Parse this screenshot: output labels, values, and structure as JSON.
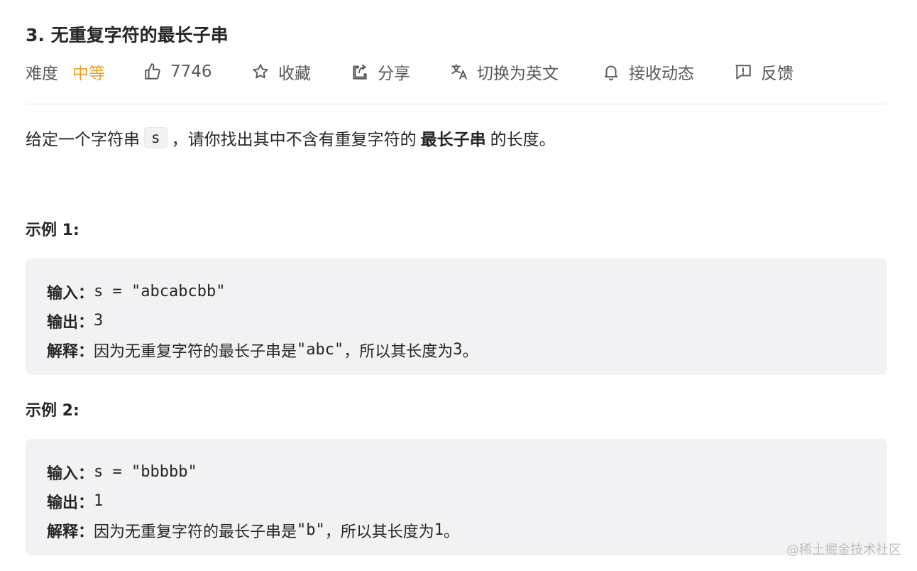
{
  "problem": {
    "title": "3. 无重复字符的最长子串"
  },
  "toolbar": {
    "difficulty_label": "难度",
    "difficulty_value": "中等",
    "likes_count": "7746",
    "favorite_label": "收藏",
    "share_label": "分享",
    "translate_label": "切换为英文",
    "subscribe_label": "接收动态",
    "feedback_label": "反馈",
    "difficulty_color": "#ef9e2b",
    "icons": [
      "thumbs-up-icon",
      "star-icon",
      "share-icon",
      "translate-icon",
      "bell-icon",
      "feedback-icon"
    ]
  },
  "description": {
    "before": "给定一个字符串",
    "code": "s",
    "middle": "，请你找出其中不含有重复字符的",
    "bold": "最长子串",
    "after": "的长度。"
  },
  "examples": [
    {
      "title": "示例 1:",
      "input_label": "输入：",
      "input_value": "s = \"abcabcbb\"",
      "output_label": "输出：",
      "output_value": "3",
      "explain_label": "解释：",
      "explain_text": "因为无重复字符的最长子串是 ",
      "explain_code": "\"abc\"",
      "explain_tail": "，所以其长度为 ",
      "explain_num": "3",
      "explain_end": "。"
    },
    {
      "title": "示例 2:",
      "input_label": "输入：",
      "input_value": "s = \"bbbbb\"",
      "output_label": "输出：",
      "output_value": "1",
      "explain_label": "解释：",
      "explain_text": "因为无重复字符的最长子串是 ",
      "explain_code": "\"b\"",
      "explain_tail": "，所以其长度为 ",
      "explain_num": "1",
      "explain_end": "。"
    }
  ],
  "watermark": "@稀土掘金技术社区"
}
